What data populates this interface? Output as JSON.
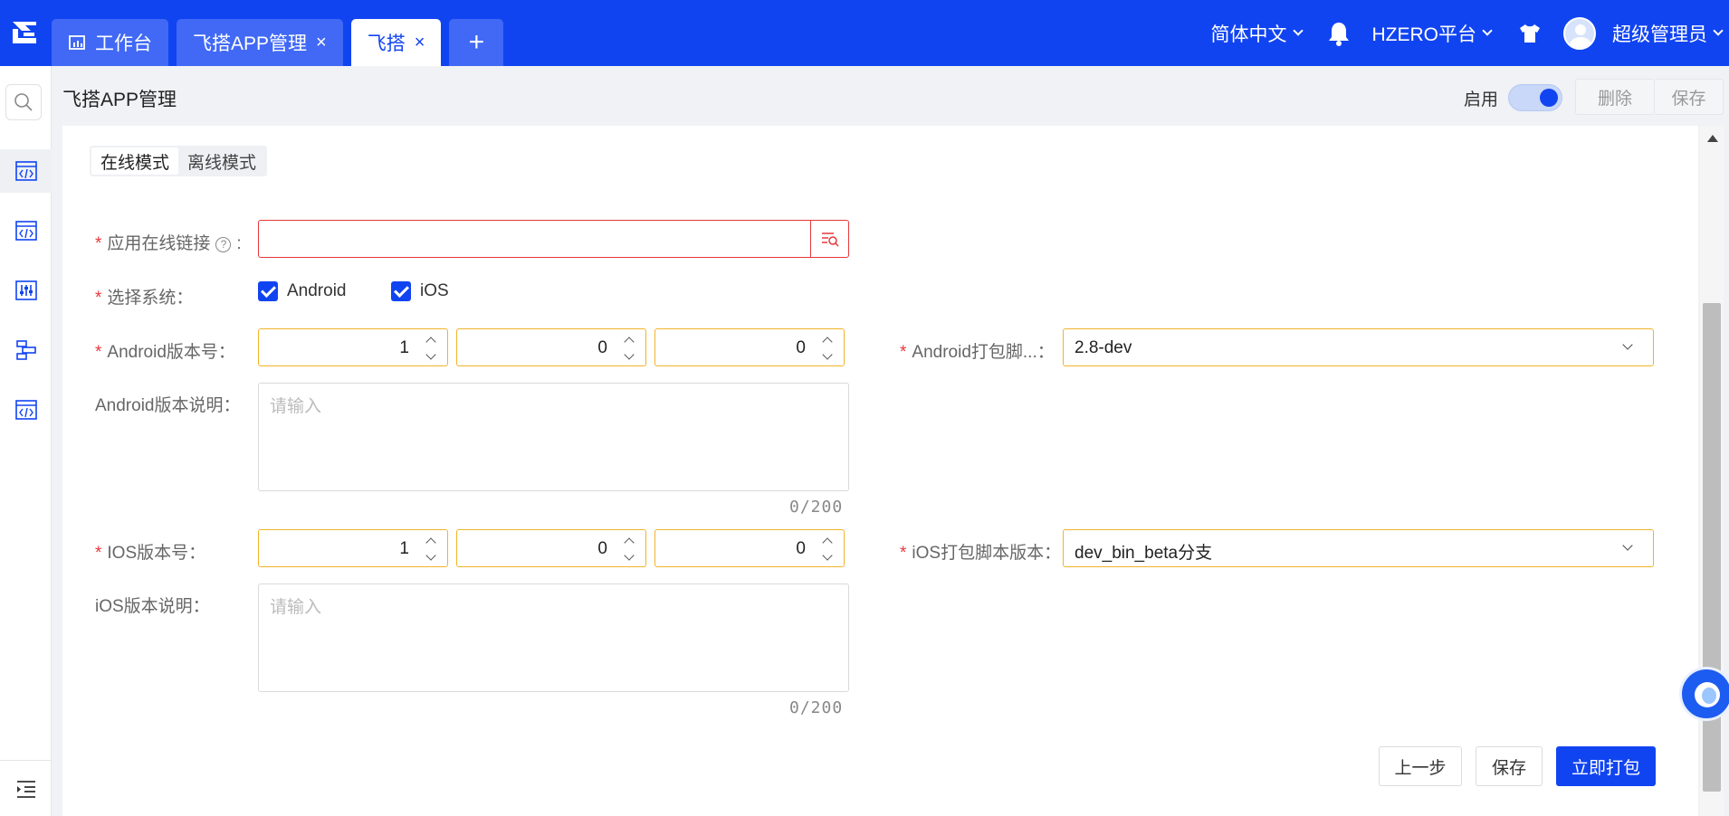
{
  "header": {
    "tabs": [
      {
        "label": "工作台",
        "icon": "dashboard-icon"
      },
      {
        "label": "飞搭APP管理",
        "close": "×"
      },
      {
        "label": "飞搭",
        "close": "×"
      },
      {
        "label": "+"
      }
    ],
    "language": "简体中文",
    "platform": "HZERO平台",
    "user": "超级管理员"
  },
  "page": {
    "title": "飞搭APP管理",
    "enable_label": "启用",
    "enabled": true,
    "delete_label": "删除",
    "save_label": "保存"
  },
  "modes": [
    "在线模式",
    "离线模式"
  ],
  "form": {
    "online_link_label": "应用在线链接",
    "online_link_value": "",
    "help_glyph": "?",
    "system_label": "选择系统：",
    "systems": [
      {
        "label": "Android",
        "checked": true
      },
      {
        "label": "iOS",
        "checked": true
      }
    ],
    "android_version_label": "Android版本号：",
    "android_version": [
      "1",
      "0",
      "0"
    ],
    "android_script_label": "Android打包脚...：",
    "android_script_value": "2.8-dev",
    "android_desc_label": "Android版本说明：",
    "android_desc_placeholder": "请输入",
    "android_desc_counter": "0/200",
    "ios_version_label": "IOS版本号：",
    "ios_version": [
      "1",
      "0",
      "0"
    ],
    "ios_script_label": "iOS打包脚本版本：",
    "ios_script_value": "dev_bin_beta分支",
    "ios_desc_label": "iOS版本说明：",
    "ios_desc_placeholder": "请输入",
    "ios_desc_counter": "0/200",
    "required_mark": "*",
    "colon": ":"
  },
  "footer": {
    "prev_label": "上一步",
    "save_label": "保存",
    "build_label": "立即打包"
  },
  "colors": {
    "brand": "#1144f1",
    "required": "#e5383b",
    "warn_border": "#f0b42a"
  }
}
